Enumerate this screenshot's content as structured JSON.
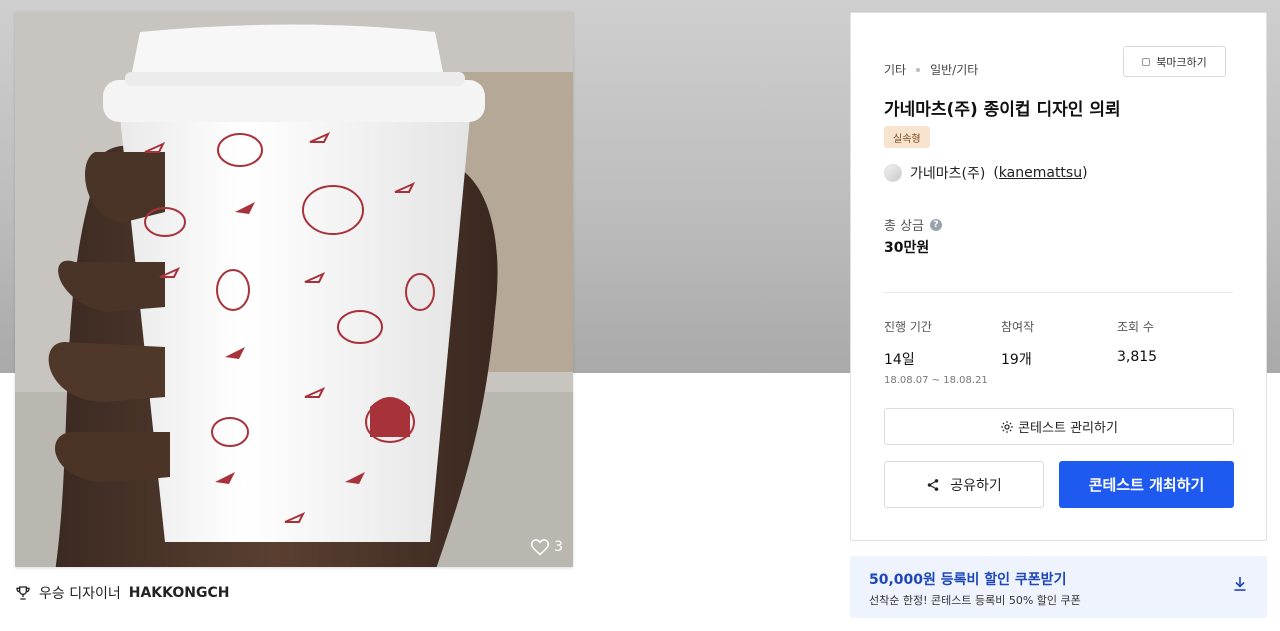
{
  "contest": {
    "category": "기타",
    "subcategory": "일반/기타",
    "bookmark_label": "북마크하기",
    "title": "가네마츠(주) 종이컵 디자인 의뢰",
    "badge": "실속형",
    "owner_name": "가네마츠(주)",
    "owner_handle_open": "(",
    "owner_handle": "kanemattsu",
    "owner_handle_close": ")",
    "prize_label": "총 상금",
    "prize_value": "30만원",
    "stats": {
      "period_label": "진행 기간",
      "period_value": "14일",
      "period_range": "18.08.07 ~ 18.08.21",
      "entries_label": "참여작",
      "entries_value": "19개",
      "views_label": "조회 수",
      "views_value": "3,815"
    },
    "manage_label": "콘테스트 관리하기",
    "share_label": "공유하기",
    "host_label": "콘테스트 개최하기"
  },
  "hero": {
    "like_count": "3"
  },
  "winner": {
    "prefix": "우승 디자이너",
    "name": "HAKKONGCH"
  },
  "coupon": {
    "headline": "50,000원 등록비 할인 쿠폰받기",
    "description": "선착순 한정! 콘테스트 등록비 50% 할인 쿠폰"
  },
  "icons": [
    "heart-icon",
    "trophy-icon",
    "help-icon",
    "gear-icon",
    "share-icon",
    "download-icon",
    "bookmark-icon"
  ],
  "colors": {
    "primary": "#1f5af0",
    "badge_bg": "#f8e3cf",
    "coupon_bg": "#eef3fd",
    "coupon_text": "#1f47b8"
  }
}
